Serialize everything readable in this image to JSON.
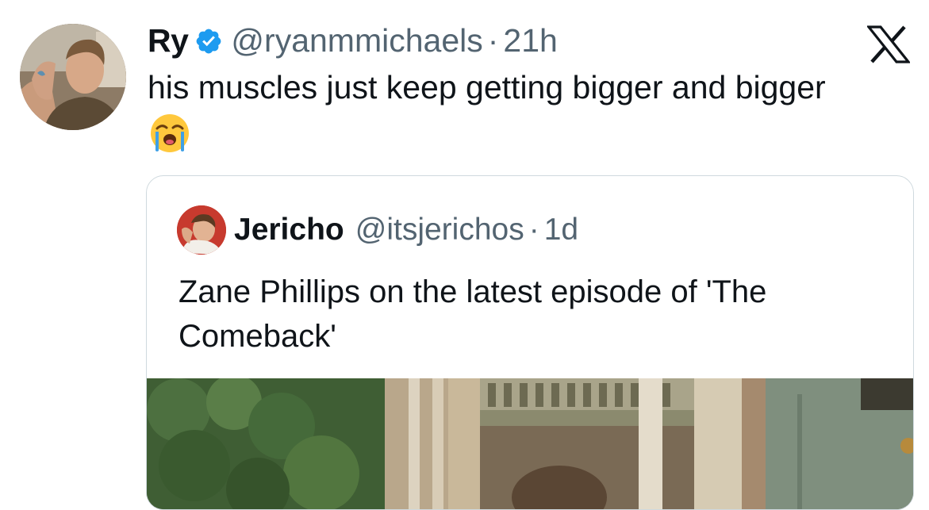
{
  "tweet": {
    "display_name": "Ry",
    "handle": "@ryanmmichaels",
    "separator": "·",
    "time": "21h",
    "text": "his muscles just keep getting bigger and bigger",
    "emoji": "loudly-crying-face",
    "verified": true
  },
  "quoted_tweet": {
    "display_name": "Jericho",
    "handle": "@itsjerichos",
    "separator": "·",
    "time": "1d",
    "text": "Zane Phillips on the latest episode of 'The Comeback'"
  },
  "colors": {
    "text": "#0f1419",
    "secondary": "#536471",
    "verified": "#1d9bf0",
    "border": "#cfd9de"
  },
  "icons": [
    "verified-badge-icon",
    "x-logo-icon",
    "loudly-crying-face-emoji"
  ]
}
